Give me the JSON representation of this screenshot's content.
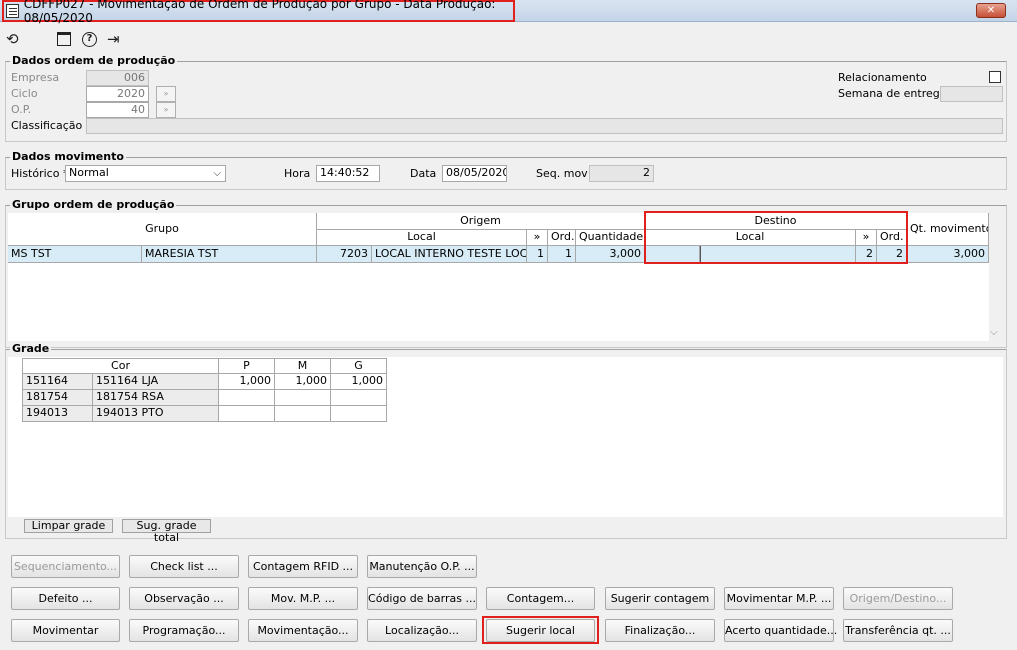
{
  "window": {
    "title": "CDFFP027 - Movimentação de Ordem de Produção por Grupo - Data Produção: 08/05/2020",
    "close": "✕"
  },
  "toolbar": {
    "undo": "⟲",
    "calendar": "▦",
    "help": "?",
    "exit": "⇥"
  },
  "dados_ordem": {
    "legend": "Dados ordem de produção",
    "empresa_label": "Empresa",
    "empresa": "006",
    "ciclo_label": "Ciclo",
    "ciclo": "2020",
    "op_label": "O.P.",
    "op": "40",
    "classificacao_label": "Classificação",
    "classificacao": "",
    "relacionamento_label": "Relacionamento",
    "semana_label": "Semana de entrega",
    "semana": "",
    "lookup": "»"
  },
  "dados_mov": {
    "legend": "Dados movimento",
    "historico_label": "Histórico *",
    "historico": "Normal",
    "hora_label": "Hora",
    "hora": "14:40:52",
    "data_label": "Data",
    "data": "08/05/2020",
    "seq_label": "Seq. mov",
    "seq": "2"
  },
  "grupo_op": {
    "legend": "Grupo ordem de produção",
    "h_grupo": "Grupo",
    "h_origem": "Origem",
    "h_destino": "Destino",
    "h_qt": "Qt. movimento",
    "h_local": "Local",
    "h_arrow": "»",
    "h_ord": "Ord.",
    "h_quantidade": "Quantidade",
    "h_local2": "Local",
    "h_arrow2": "»",
    "h_ord2": "Ord.",
    "row": {
      "grupo_cod": "MS TST",
      "grupo": "MARESIA TST",
      "local_cod": "7203",
      "local": "LOCAL INTERNO TESTE LOCAL",
      "seta": "1",
      "ord": "1",
      "quantidade": "3,000",
      "dest_local_cod": "",
      "dest_local": "",
      "dest_seta": "2",
      "dest_ord": "2",
      "qt": "3,000"
    }
  },
  "grade": {
    "legend": "Grade",
    "h_cor": "Cor",
    "h_sizes": [
      "P",
      "M",
      "G"
    ],
    "rows": [
      {
        "cod": "151164",
        "desc": "151164 LJA",
        "p": "1,000",
        "m": "1,000",
        "g": "1,000"
      },
      {
        "cod": "181754",
        "desc": "181754 RSA",
        "p": "",
        "m": "",
        "g": ""
      },
      {
        "cod": "194013",
        "desc": "194013 PTO",
        "p": "",
        "m": "",
        "g": ""
      }
    ],
    "limpar": "Limpar grade",
    "sug_total": "Sug. grade total"
  },
  "buttons": {
    "sequenciamento": "Sequenciamento...",
    "check_list": "Check list ...",
    "contagem_rfid": "Contagem RFID ...",
    "manutencao": "Manutenção O.P. ...",
    "defeito": "Defeito ...",
    "observacao": "Observação ...",
    "mov_mp": "Mov. M.P. ...",
    "codigo_barras": "Código de barras ...",
    "contagem": "Contagem...",
    "sugerir_contagem": "Sugerir contagem",
    "movimentar_mp": "Movimentar M.P. ...",
    "origem_destino": "Origem/Destino...",
    "movimentar": "Movimentar",
    "programacao": "Programação...",
    "movimentacao": "Movimentação...",
    "localizacao": "Localização...",
    "sugerir_local": "Sugerir local",
    "finalizacao": "Finalização...",
    "acerto_qtd": "Acerto quantidade...",
    "transferencia": "Transferência qt. ..."
  }
}
